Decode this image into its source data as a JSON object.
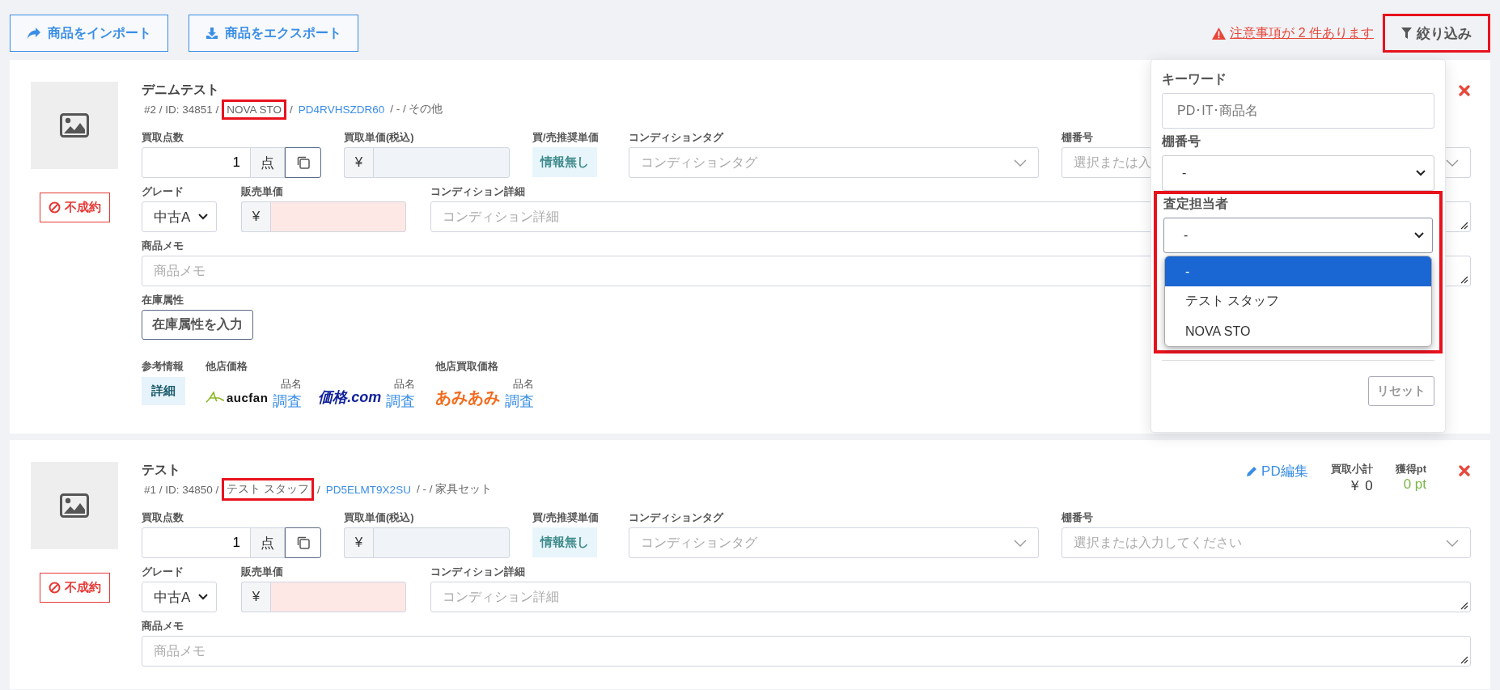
{
  "toolbar": {
    "buttons": [
      {
        "label": "商品をインポート",
        "kind": "share"
      },
      {
        "label": "商品をエクスポート",
        "kind": "download"
      }
    ],
    "warning": "注意事項が 2 件あります",
    "filter": {
      "label": "絞り込み",
      "highlighted": true
    }
  },
  "filter_panel": {
    "keyword": {
      "label": "キーワード",
      "placeholder": "PD･IT･商品名"
    },
    "shelf": {
      "label": "棚番号",
      "value": "-"
    },
    "assessor": {
      "label": "査定担当者",
      "value": "-",
      "highlighted": true,
      "options": [
        {
          "label": "-",
          "selected": true
        },
        {
          "label": "テスト スタッフ",
          "selected": false
        },
        {
          "label": "NOVA STO",
          "selected": false
        }
      ]
    },
    "reset": "リセット"
  },
  "items": [
    {
      "status": "不成約",
      "title": "デニムテスト",
      "meta": [
        {
          "kind": "text",
          "text": "#2 / ID: 34851 /"
        },
        {
          "kind": "staff",
          "text": "NOVA STO",
          "highlighted": true
        },
        {
          "kind": "text",
          "text": "/"
        },
        {
          "kind": "link",
          "text": "PD4RVHSZDR60"
        },
        {
          "kind": "text",
          "text": "/ - / その他"
        }
      ],
      "qty": {
        "label": "買取点数",
        "value": "1",
        "unit": "点"
      },
      "buy_price": {
        "label": "買取単価(税込)",
        "currency": "¥"
      },
      "recommended": {
        "label": "買/売推奨単価",
        "value": "情報無し"
      },
      "condition_tag": {
        "label": "コンディションタグ",
        "placeholder": "コンディションタグ"
      },
      "shelf": {
        "label": "棚番号",
        "placeholder": "選択または入"
      },
      "grade": {
        "label": "グレード",
        "value": "中古A"
      },
      "sale_price": {
        "label": "販売単価",
        "currency": "¥"
      },
      "condition_detail": {
        "label": "コンディション詳細",
        "placeholder": "コンディション詳細"
      },
      "memo": {
        "label": "商品メモ",
        "placeholder": "商品メモ"
      },
      "stock_attr": {
        "label": "在庫属性",
        "button": "在庫属性を入力"
      },
      "reference": {
        "label": "参考情報",
        "button": "詳細",
        "other_price_label": "他店価格",
        "other_buy_label": "他店買取価格",
        "sites": [
          {
            "kind": "aucfan",
            "logo": "aucfan",
            "caption": "品名",
            "link": "調査"
          },
          {
            "kind": "kakaku",
            "logo": "価格.com",
            "caption": "品名",
            "link": "調査"
          },
          {
            "kind": "amiami",
            "logo": "あみあみ",
            "caption": "品名",
            "link": "調査"
          }
        ]
      }
    },
    {
      "status": "不成約",
      "title": "テスト",
      "meta": [
        {
          "kind": "text",
          "text": "#1 / ID: 34850 /"
        },
        {
          "kind": "staff",
          "text": "テスト スタッフ",
          "highlighted": true
        },
        {
          "kind": "text",
          "text": "/"
        },
        {
          "kind": "link",
          "text": "PD5ELMT9X2SU"
        },
        {
          "kind": "text",
          "text": "/ - / 家具セット"
        }
      ],
      "header": {
        "edit": "PD編集",
        "subtotal_label": "買取小計",
        "subtotal": "￥ 0",
        "points_label": "獲得pt",
        "points": "0 pt"
      },
      "qty": {
        "label": "買取点数",
        "value": "1",
        "unit": "点"
      },
      "buy_price": {
        "label": "買取単価(税込)",
        "currency": "¥"
      },
      "recommended": {
        "label": "買/売推奨単価",
        "value": "情報無し"
      },
      "condition_tag": {
        "label": "コンディションタグ",
        "placeholder": "コンディションタグ"
      },
      "shelf": {
        "label": "棚番号",
        "placeholder": "選択または入力してください"
      },
      "grade": {
        "label": "グレード",
        "value": "中古A"
      },
      "sale_price": {
        "label": "販売単価",
        "currency": "¥"
      },
      "condition_detail": {
        "label": "コンディション詳細",
        "placeholder": "コンディション詳細"
      },
      "memo": {
        "label": "商品メモ",
        "placeholder": "商品メモ"
      }
    }
  ]
}
